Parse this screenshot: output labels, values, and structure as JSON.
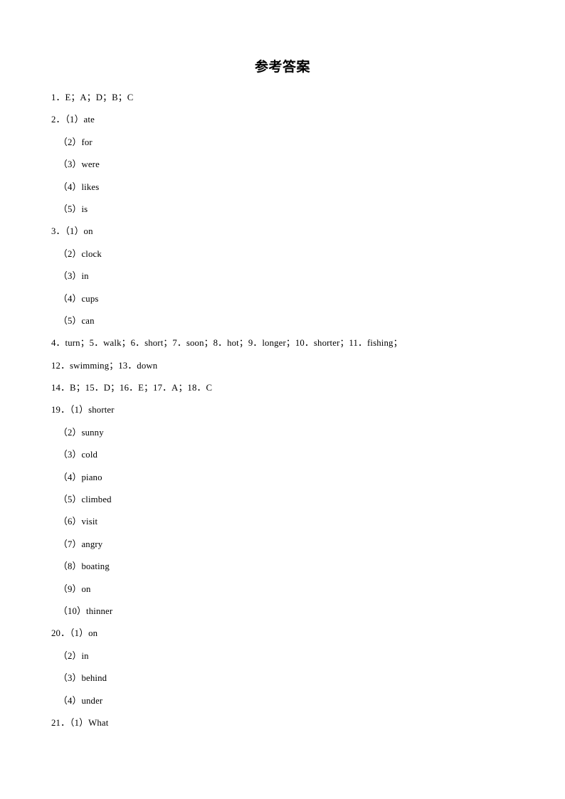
{
  "document": {
    "title": "参考答案",
    "page_background": "#ffffff",
    "text_color": "#000000"
  },
  "answers": [
    {
      "id": "ans-1",
      "indent": "main",
      "text": "1．E；A；D；B；C"
    },
    {
      "id": "ans-2-1",
      "indent": "main",
      "text": "2．（1）ate"
    },
    {
      "id": "ans-2-2",
      "indent": "sub",
      "text": "（2）for"
    },
    {
      "id": "ans-2-3",
      "indent": "sub",
      "text": "（3）were"
    },
    {
      "id": "ans-2-4",
      "indent": "sub",
      "text": "（4）likes"
    },
    {
      "id": "ans-2-5",
      "indent": "sub",
      "text": "（5）is"
    },
    {
      "id": "ans-3-1",
      "indent": "main",
      "text": "3．（1）on"
    },
    {
      "id": "ans-3-2",
      "indent": "sub",
      "text": "（2）clock"
    },
    {
      "id": "ans-3-3",
      "indent": "sub",
      "text": "（3）in"
    },
    {
      "id": "ans-3-4",
      "indent": "sub",
      "text": "（4）cups"
    },
    {
      "id": "ans-3-5",
      "indent": "sub",
      "text": "（5）can"
    },
    {
      "id": "ans-4-to-11",
      "indent": "main",
      "text": "4．turn；5．walk；6．short；7．soon；8．hot；9．longer；10．shorter；11．fishing；"
    },
    {
      "id": "ans-12-to-13",
      "indent": "main",
      "text": "12．swimming；13．down"
    },
    {
      "id": "ans-14-to-18",
      "indent": "main",
      "text": "14．B；15．D；16．E；17．A；18．C"
    },
    {
      "id": "ans-19-1",
      "indent": "main",
      "text": "19．（1）shorter"
    },
    {
      "id": "ans-19-2",
      "indent": "sub",
      "text": "（2）sunny"
    },
    {
      "id": "ans-19-3",
      "indent": "sub",
      "text": "（3）cold"
    },
    {
      "id": "ans-19-4",
      "indent": "sub",
      "text": "（4）piano"
    },
    {
      "id": "ans-19-5",
      "indent": "sub",
      "text": "（5）climbed"
    },
    {
      "id": "ans-19-6",
      "indent": "sub",
      "text": "（6）visit"
    },
    {
      "id": "ans-19-7",
      "indent": "sub",
      "text": "（7）angry"
    },
    {
      "id": "ans-19-8",
      "indent": "sub",
      "text": "（8）boating"
    },
    {
      "id": "ans-19-9",
      "indent": "sub",
      "text": "（9）on"
    },
    {
      "id": "ans-19-10",
      "indent": "sub",
      "text": "（10）thinner"
    },
    {
      "id": "ans-20-1",
      "indent": "main",
      "text": "20．（1）on"
    },
    {
      "id": "ans-20-2",
      "indent": "sub",
      "text": "（2）in"
    },
    {
      "id": "ans-20-3",
      "indent": "sub",
      "text": "（3）behind"
    },
    {
      "id": "ans-20-4",
      "indent": "sub",
      "text": "（4）under"
    },
    {
      "id": "ans-21-1",
      "indent": "main",
      "text": "21．（1）What"
    }
  ]
}
